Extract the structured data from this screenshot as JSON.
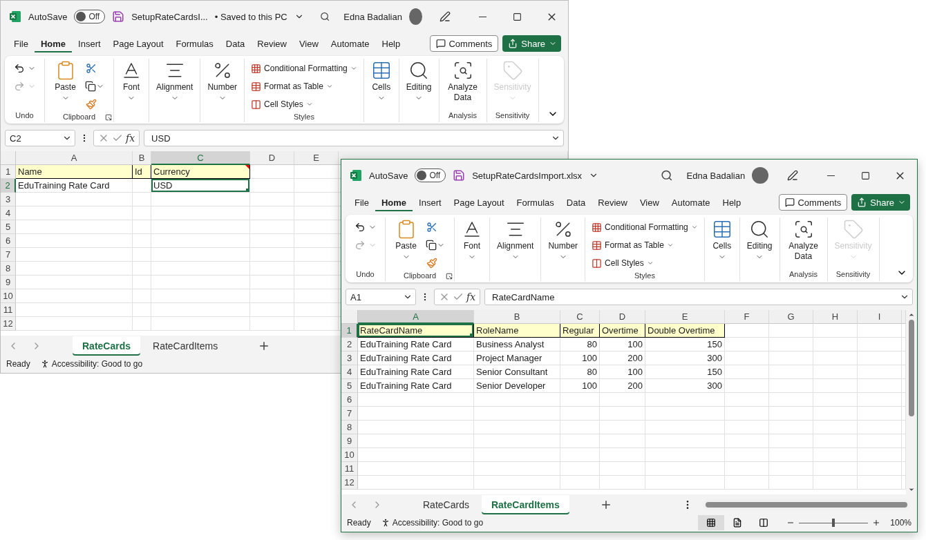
{
  "windows": [
    {
      "active": false,
      "title_bar": {
        "autosave_label": "AutoSave",
        "autosave": {
          "on": false,
          "label": "Off"
        },
        "file_name": "SetupRateCardsI...",
        "save_status": "• Saved to this PC",
        "user": "Edna Badalian"
      },
      "menu": [
        {
          "label": "File",
          "selected": false
        },
        {
          "label": "Home",
          "selected": true
        },
        {
          "label": "Insert",
          "selected": false
        },
        {
          "label": "Page Layout",
          "selected": false
        },
        {
          "label": "Formulas",
          "selected": false
        },
        {
          "label": "Data",
          "selected": false
        },
        {
          "label": "Review",
          "selected": false
        },
        {
          "label": "View",
          "selected": false
        },
        {
          "label": "Automate",
          "selected": false
        },
        {
          "label": "Help",
          "selected": false
        }
      ],
      "comments": "Comments",
      "share": "Share",
      "ribbon": [
        {
          "kind": "undo",
          "label": "Undo",
          "disabled": false
        },
        {
          "kind": "clipboard",
          "label": "Clipboard",
          "button": "Paste",
          "disabled": false
        },
        {
          "kind": "font",
          "button": "Font",
          "disabled": false
        },
        {
          "kind": "alignment",
          "button": "Alignment",
          "disabled": false
        },
        {
          "kind": "number",
          "button": "Number",
          "disabled": false
        },
        {
          "kind": "styles",
          "label": "Styles",
          "buttons": [
            "Conditional Formatting",
            "Format as Table",
            "Cell Styles"
          ],
          "disabled": false
        },
        {
          "kind": "cells",
          "button": "Cells",
          "disabled": false
        },
        {
          "kind": "editing",
          "button": "Editing",
          "disabled": false
        },
        {
          "kind": "analysis",
          "label": "Analysis",
          "button": "Analyze Data",
          "disabled": false
        },
        {
          "kind": "sensitivity",
          "label": "Sensitivity",
          "button": "Sensitivity",
          "disabled": true
        }
      ],
      "name_box": "C2",
      "function_label": "fx",
      "formula": "USD",
      "grid": {
        "columns": [
          {
            "label": "A",
            "selected": false
          },
          {
            "label": "B",
            "selected": false
          },
          {
            "label": "C",
            "selected": true
          },
          {
            "label": "D",
            "selected": false
          },
          {
            "label": "E",
            "selected": false
          }
        ],
        "rows": [
          {
            "label": "1",
            "selected": false,
            "kind": "header",
            "cells": [
              {
                "text": "Name",
                "kind": "text",
                "note": false
              },
              {
                "text": "Id",
                "kind": "text",
                "note": false
              },
              {
                "text": "Currency",
                "kind": "text",
                "note": true
              }
            ]
          },
          {
            "label": "2",
            "selected": true,
            "kind": "data",
            "cells": [
              {
                "text": "EduTraining Rate Card",
                "kind": "text",
                "note": false
              },
              {
                "kind": "empty",
                "note": false
              },
              {
                "text": "USD",
                "kind": "text",
                "note": false
              }
            ]
          },
          {
            "label": "3",
            "selected": false,
            "kind": "empty"
          },
          {
            "label": "4",
            "selected": false,
            "kind": "empty"
          },
          {
            "label": "5",
            "selected": false,
            "kind": "empty"
          },
          {
            "label": "6",
            "selected": false,
            "kind": "empty"
          },
          {
            "label": "7",
            "selected": false,
            "kind": "empty"
          },
          {
            "label": "8",
            "selected": false,
            "kind": "empty"
          },
          {
            "label": "9",
            "selected": false,
            "kind": "empty"
          },
          {
            "label": "10",
            "selected": false,
            "kind": "empty"
          },
          {
            "label": "11",
            "selected": false,
            "kind": "empty"
          },
          {
            "label": "12",
            "selected": false,
            "kind": "empty"
          }
        ]
      },
      "sheets": [
        {
          "label": "RateCards",
          "selected": true
        },
        {
          "label": "RateCardItems",
          "selected": false
        }
      ],
      "status": {
        "ready": "Ready",
        "accessibility": "Accessibility: Good to go"
      }
    },
    {
      "active": true,
      "title_bar": {
        "autosave_label": "AutoSave",
        "autosave": {
          "on": false,
          "label": "Off"
        },
        "file_name": "SetupRateCardsImport.xlsx",
        "user": "Edna Badalian"
      },
      "menu": [
        {
          "label": "File",
          "selected": false
        },
        {
          "label": "Home",
          "selected": true
        },
        {
          "label": "Insert",
          "selected": false
        },
        {
          "label": "Page Layout",
          "selected": false
        },
        {
          "label": "Formulas",
          "selected": false
        },
        {
          "label": "Data",
          "selected": false
        },
        {
          "label": "Review",
          "selected": false
        },
        {
          "label": "View",
          "selected": false
        },
        {
          "label": "Automate",
          "selected": false
        },
        {
          "label": "Help",
          "selected": false
        }
      ],
      "comments": "Comments",
      "share": "Share",
      "ribbon": [
        {
          "kind": "undo",
          "label": "Undo",
          "disabled": false
        },
        {
          "kind": "clipboard",
          "label": "Clipboard",
          "button": "Paste",
          "disabled": false
        },
        {
          "kind": "font",
          "button": "Font",
          "disabled": false
        },
        {
          "kind": "alignment",
          "button": "Alignment",
          "disabled": false
        },
        {
          "kind": "number",
          "button": "Number",
          "disabled": false
        },
        {
          "kind": "styles",
          "label": "Styles",
          "buttons": [
            "Conditional Formatting",
            "Format as Table",
            "Cell Styles"
          ],
          "disabled": false
        },
        {
          "kind": "cells",
          "button": "Cells",
          "disabled": false
        },
        {
          "kind": "editing",
          "button": "Editing",
          "disabled": false
        },
        {
          "kind": "analysis",
          "label": "Analysis",
          "button": "Analyze Data",
          "disabled": false
        },
        {
          "kind": "sensitivity",
          "label": "Sensitivity",
          "button": "Sensitivity",
          "disabled": true
        }
      ],
      "name_box": "A1",
      "function_label": "fx",
      "formula": "RateCardName",
      "grid": {
        "columns": [
          {
            "label": "A",
            "selected": true
          },
          {
            "label": "B",
            "selected": false
          },
          {
            "label": "C",
            "selected": false
          },
          {
            "label": "D",
            "selected": false
          },
          {
            "label": "E",
            "selected": false
          },
          {
            "label": "F",
            "selected": false
          },
          {
            "label": "G",
            "selected": false
          },
          {
            "label": "H",
            "selected": false
          },
          {
            "label": "I",
            "selected": false
          }
        ],
        "rows": [
          {
            "label": "1",
            "selected": true,
            "kind": "header",
            "cells": [
              {
                "text": "RateCardName",
                "kind": "text",
                "note": false
              },
              {
                "text": "RoleName",
                "kind": "text",
                "note": false
              },
              {
                "text": "Regular",
                "kind": "text",
                "note": false
              },
              {
                "text": "Overtime",
                "kind": "text",
                "note": false
              },
              {
                "text": "Double Overtime",
                "kind": "text",
                "note": false
              }
            ]
          },
          {
            "label": "2",
            "selected": false,
            "kind": "data",
            "cells": [
              {
                "text": "EduTraining Rate Card",
                "kind": "text",
                "note": false
              },
              {
                "text": "Business Analyst",
                "kind": "text",
                "note": false
              },
              {
                "text": "80",
                "kind": "number",
                "note": false
              },
              {
                "text": "100",
                "kind": "number",
                "note": false
              },
              {
                "text": "150",
                "kind": "number",
                "note": false
              }
            ]
          },
          {
            "label": "3",
            "selected": false,
            "kind": "data",
            "cells": [
              {
                "text": "EduTraining Rate Card",
                "kind": "text",
                "note": false
              },
              {
                "text": "Project Manager",
                "kind": "text",
                "note": false
              },
              {
                "text": "100",
                "kind": "number",
                "note": false
              },
              {
                "text": "200",
                "kind": "number",
                "note": false
              },
              {
                "text": "300",
                "kind": "number",
                "note": false
              }
            ]
          },
          {
            "label": "4",
            "selected": false,
            "kind": "data",
            "cells": [
              {
                "text": "EduTraining Rate Card",
                "kind": "text",
                "note": false
              },
              {
                "text": "Senior Consultant",
                "kind": "text",
                "note": false
              },
              {
                "text": "80",
                "kind": "number",
                "note": false
              },
              {
                "text": "100",
                "kind": "number",
                "note": false
              },
              {
                "text": "150",
                "kind": "number",
                "note": false
              }
            ]
          },
          {
            "label": "5",
            "selected": false,
            "kind": "data",
            "cells": [
              {
                "text": "EduTraining Rate Card",
                "kind": "text",
                "note": false
              },
              {
                "text": "Senior Developer",
                "kind": "text",
                "note": false
              },
              {
                "text": "100",
                "kind": "number",
                "note": false
              },
              {
                "text": "200",
                "kind": "number",
                "note": false
              },
              {
                "text": "300",
                "kind": "number",
                "note": false
              }
            ]
          },
          {
            "label": "6",
            "selected": false,
            "kind": "empty"
          },
          {
            "label": "7",
            "selected": false,
            "kind": "empty"
          },
          {
            "label": "8",
            "selected": false,
            "kind": "empty"
          },
          {
            "label": "9",
            "selected": false,
            "kind": "empty"
          },
          {
            "label": "10",
            "selected": false,
            "kind": "empty"
          },
          {
            "label": "11",
            "selected": false,
            "kind": "empty"
          },
          {
            "label": "12",
            "selected": false,
            "kind": "empty"
          }
        ]
      },
      "scrollbars": true,
      "sheets": [
        {
          "label": "RateCards",
          "selected": false
        },
        {
          "label": "RateCardItems",
          "selected": true
        }
      ],
      "status": {
        "ready": "Ready",
        "accessibility": "Accessibility: Good to go",
        "views": [
          {
            "selected": true
          },
          {
            "selected": false
          },
          {
            "selected": false
          }
        ],
        "zoom": {
          "level": 0.5,
          "label": "100%"
        }
      }
    }
  ]
}
